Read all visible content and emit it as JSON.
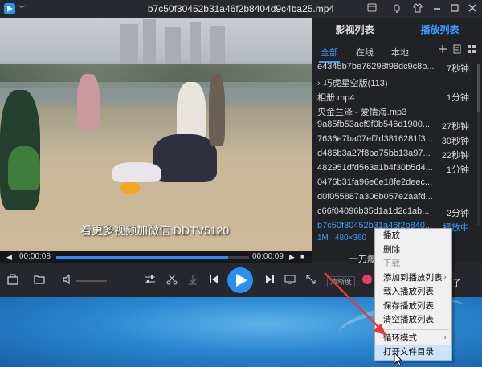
{
  "window": {
    "title": "b7c50f30452b31a46f2b8404d9c4ba25.mp4",
    "title_chevron": "﹀"
  },
  "video": {
    "watermark": "看更多视频加微信:DDTV5120"
  },
  "progress": {
    "current_time": "00:00:08",
    "total_time": "00:00:09",
    "fraction": 0.89
  },
  "controls": {
    "quality_label": "清晰度",
    "partial_text": "子",
    "partial_text2": "一刀爆"
  },
  "panel": {
    "tabs": [
      "影视列表",
      "播放列表"
    ],
    "active_tab": "播放列表",
    "sub_tabs": [
      "全部",
      "在线",
      "本地"
    ],
    "active_sub_tab": "全部",
    "items": [
      {
        "name": "e4345b7be76298f98dc9c8b...",
        "duration": "7秒钟",
        "folder": false
      },
      {
        "name": "巧虎星空版(113)",
        "duration": "",
        "folder": true
      },
      {
        "name": "相册.mp4",
        "duration": "1分钟",
        "folder": false
      },
      {
        "name": "央金兰泽 - 爱情海.mp3",
        "duration": "",
        "folder": false
      },
      {
        "name": "9a85fb53acf9f0b546d1900...",
        "duration": "27秒钟",
        "folder": false
      },
      {
        "name": "7636e7ba07ef7d3816281f3...",
        "duration": "30秒钟",
        "folder": false
      },
      {
        "name": "d486b3a27f8ba75bb13a97...",
        "duration": "22秒钟",
        "folder": false
      },
      {
        "name": "482951dfd563a1b4f30b5d4...",
        "duration": "1分钟",
        "folder": false
      },
      {
        "name": "0476b31fa96e6e18fe2deec...",
        "duration": "",
        "folder": false
      },
      {
        "name": "d0f055887a306b057e2aafd...",
        "duration": "",
        "folder": false
      },
      {
        "name": "c66f04096b35d1a1d2c1ab...",
        "duration": "2分钟",
        "folder": false
      },
      {
        "name": "b7c50f30452b31a46f2b840...",
        "duration": "播放中",
        "folder": false,
        "active": true
      }
    ],
    "active_meta": {
      "size": "1M",
      "resolution": "480×360"
    }
  },
  "context_menu": {
    "items": [
      {
        "label": "播放",
        "disabled": false,
        "submenu": false
      },
      {
        "label": "删除",
        "disabled": false,
        "submenu": false
      },
      {
        "label": "下载",
        "disabled": true,
        "submenu": false
      },
      {
        "label": "添加到播放列表",
        "disabled": false,
        "submenu": true
      },
      {
        "label": "载入播放列表",
        "disabled": false,
        "submenu": false
      },
      {
        "label": "保存播放列表",
        "disabled": false,
        "submenu": false
      },
      {
        "label": "清空播放列表",
        "disabled": false,
        "submenu": false
      },
      {
        "label": "循环模式",
        "disabled": false,
        "submenu": true
      },
      {
        "label": "打开文件目录",
        "disabled": false,
        "submenu": false,
        "highlight": true
      }
    ]
  },
  "colors": {
    "accent": "#3d9bff",
    "annotation": "#e53935"
  }
}
